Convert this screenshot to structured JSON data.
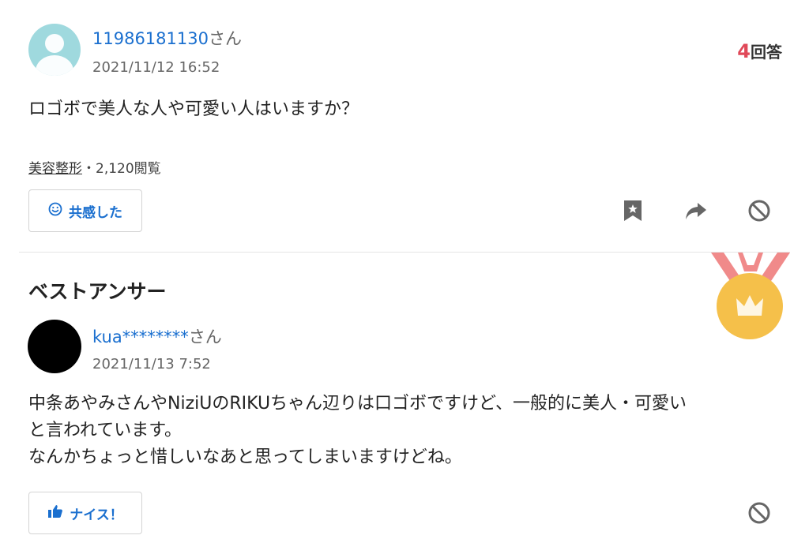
{
  "question": {
    "user": {
      "name": "11986181130",
      "suffix": "さん"
    },
    "date": "2021/11/12 16:52",
    "answer_count": {
      "number": "4",
      "label": "回答"
    },
    "text": "ロゴボで美人な人や可愛い人はいますか？",
    "category": "美容整形",
    "views": "・2,120閲覧",
    "empathy_button": "共感した"
  },
  "best_answer": {
    "title": "ベストアンサー",
    "user": {
      "name": "kua********",
      "suffix": "さん"
    },
    "date": "2021/11/13 7:52",
    "lines": [
      "中条あやみさんやNiziUのRIKUちゃん辺りは口ゴボですけど、一般的に美人・可愛い",
      "と言われています。",
      "なんかちょっと惜しいなあと思ってしまいますけどね。"
    ],
    "nice_button": "ナイス！"
  },
  "colors": {
    "link": "#1a6fcf",
    "accent": "#e04858",
    "medal": "#f5c04a",
    "ribbon": "#f08a8a"
  }
}
